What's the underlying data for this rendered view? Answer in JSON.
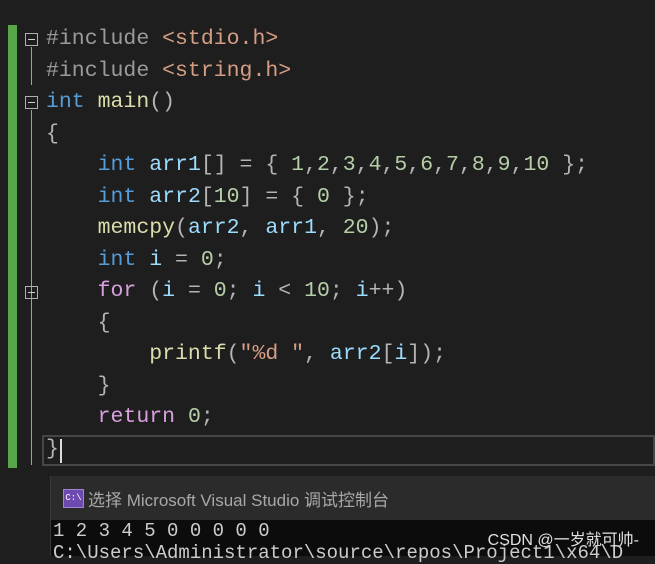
{
  "editor": {
    "lines": [
      [
        [
          "#include",
          "pp"
        ],
        [
          " ",
          "ws"
        ],
        [
          "<stdio.h>",
          "str"
        ]
      ],
      [
        [
          "#include",
          "pp"
        ],
        [
          " ",
          "ws"
        ],
        [
          "<string.h>",
          "str"
        ]
      ],
      [
        [
          "int",
          "kw"
        ],
        [
          " ",
          ""
        ],
        [
          "main",
          "fn"
        ],
        [
          "()",
          "pun"
        ]
      ],
      [
        [
          "{",
          "pun"
        ]
      ],
      [
        [
          "    ",
          ""
        ],
        [
          "int",
          "kw"
        ],
        [
          " ",
          ""
        ],
        [
          "arr1",
          "var"
        ],
        [
          "[] = { ",
          "pun"
        ],
        [
          "1",
          "num"
        ],
        [
          ",",
          "pun"
        ],
        [
          "2",
          "num"
        ],
        [
          ",",
          "pun"
        ],
        [
          "3",
          "num"
        ],
        [
          ",",
          "pun"
        ],
        [
          "4",
          "num"
        ],
        [
          ",",
          "pun"
        ],
        [
          "5",
          "num"
        ],
        [
          ",",
          "pun"
        ],
        [
          "6",
          "num"
        ],
        [
          ",",
          "pun"
        ],
        [
          "7",
          "num"
        ],
        [
          ",",
          "pun"
        ],
        [
          "8",
          "num"
        ],
        [
          ",",
          "pun"
        ],
        [
          "9",
          "num"
        ],
        [
          ",",
          "pun"
        ],
        [
          "10",
          "num"
        ],
        [
          " };",
          "pun"
        ]
      ],
      [
        [
          "    ",
          ""
        ],
        [
          "int",
          "kw"
        ],
        [
          " ",
          ""
        ],
        [
          "arr2",
          "var"
        ],
        [
          "[",
          "pun"
        ],
        [
          "10",
          "num"
        ],
        [
          "] = { ",
          "pun"
        ],
        [
          "0",
          "num"
        ],
        [
          " };",
          "pun"
        ]
      ],
      [
        [
          "    ",
          ""
        ],
        [
          "memcpy",
          "fn"
        ],
        [
          "(",
          "pun"
        ],
        [
          "arr2",
          "var"
        ],
        [
          ", ",
          "pun"
        ],
        [
          "arr1",
          "var"
        ],
        [
          ", ",
          "pun"
        ],
        [
          "20",
          "num"
        ],
        [
          ");",
          "pun"
        ]
      ],
      [
        [
          "    ",
          ""
        ],
        [
          "int",
          "kw"
        ],
        [
          " ",
          ""
        ],
        [
          "i",
          "var"
        ],
        [
          " = ",
          "pun"
        ],
        [
          "0",
          "num"
        ],
        [
          ";",
          "pun"
        ]
      ],
      [
        [
          "    ",
          ""
        ],
        [
          "for",
          "ret"
        ],
        [
          " (",
          "pun"
        ],
        [
          "i",
          "var"
        ],
        [
          " = ",
          "pun"
        ],
        [
          "0",
          "num"
        ],
        [
          "; ",
          "pun"
        ],
        [
          "i",
          "var"
        ],
        [
          " < ",
          "pun"
        ],
        [
          "10",
          "num"
        ],
        [
          "; ",
          "pun"
        ],
        [
          "i",
          "var"
        ],
        [
          "++)",
          "pun"
        ]
      ],
      [
        [
          "    ",
          ""
        ],
        [
          "{",
          "pun"
        ]
      ],
      [
        [
          "        ",
          ""
        ],
        [
          "printf",
          "fn"
        ],
        [
          "(",
          "pun"
        ],
        [
          "\"%d \"",
          "str"
        ],
        [
          ", ",
          "pun"
        ],
        [
          "arr2",
          "var"
        ],
        [
          "[",
          "pun"
        ],
        [
          "i",
          "var"
        ],
        [
          "]);",
          "pun"
        ]
      ],
      [
        [
          "    ",
          ""
        ],
        [
          "}",
          "pun"
        ]
      ],
      [
        [
          "    ",
          ""
        ],
        [
          "return",
          "ret"
        ],
        [
          " ",
          ""
        ],
        [
          "0",
          "num"
        ],
        [
          ";",
          "pun"
        ]
      ],
      [
        [
          "}",
          "pun"
        ]
      ]
    ]
  },
  "console": {
    "icon_label": "C:\\",
    "title": "选择 Microsoft Visual Studio 调试控制台",
    "output": [
      "1 2 3 4 5 0 0 0 0 0",
      "C:\\Users\\Administrator\\source\\repos\\Project1\\x64\\D"
    ]
  },
  "watermark": "CSDN @一岁就可帅-"
}
